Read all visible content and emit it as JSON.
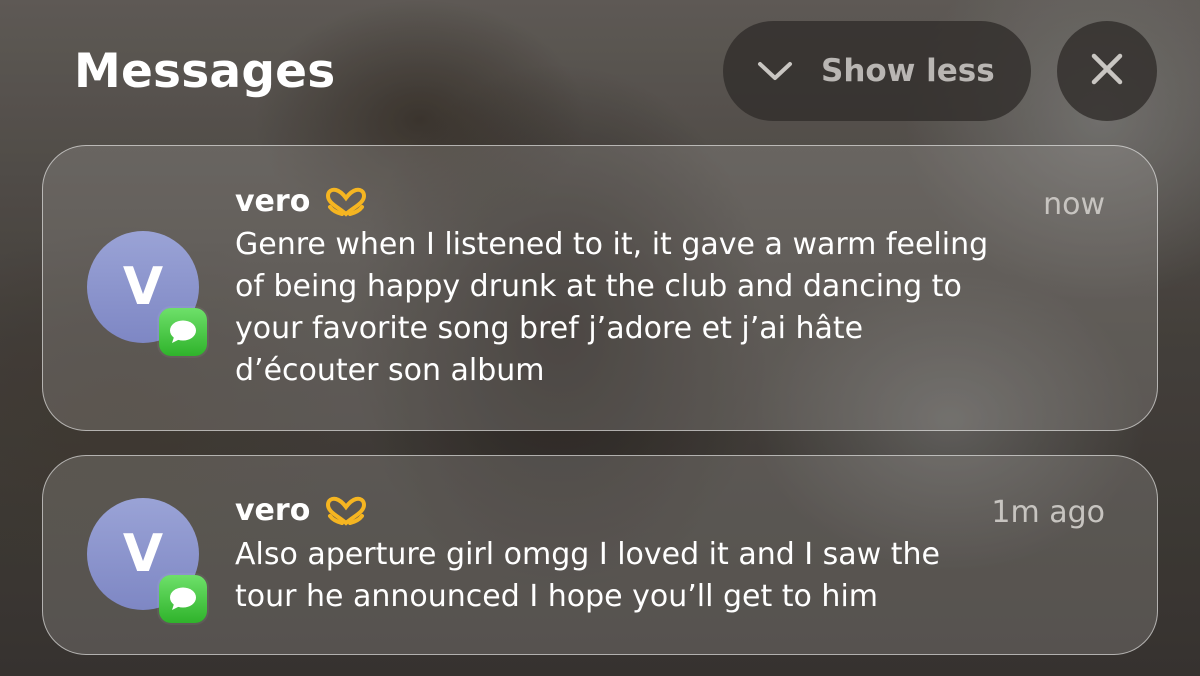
{
  "header": {
    "title": "Messages",
    "show_less_label": "Show less",
    "chevron_icon": "chevron-down-icon",
    "close_icon": "close-icon"
  },
  "notifications": [
    {
      "sender": "vero",
      "time": "now",
      "avatar_initial": "V",
      "app_icon": "messages-icon",
      "emoji_icon": "heart-hands-emoji",
      "body": "Genre when I listened to it, it gave a warm feeling\nof being happy drunk at the club and dancing to\nyour favorite song  bref j’adore et j’ai hâte\nd’écouter son album"
    },
    {
      "sender": "vero",
      "time": "1m ago",
      "avatar_initial": "V",
      "app_icon": "messages-icon",
      "emoji_icon": "heart-hands-emoji",
      "body": "Also aperture girl omgg I loved it and I saw the\ntour he announced I hope you’ll get to him"
    }
  ],
  "colors": {
    "avatar": "#8a93cc",
    "messages_badge": "#34c759",
    "emoji": "#f5b521"
  }
}
